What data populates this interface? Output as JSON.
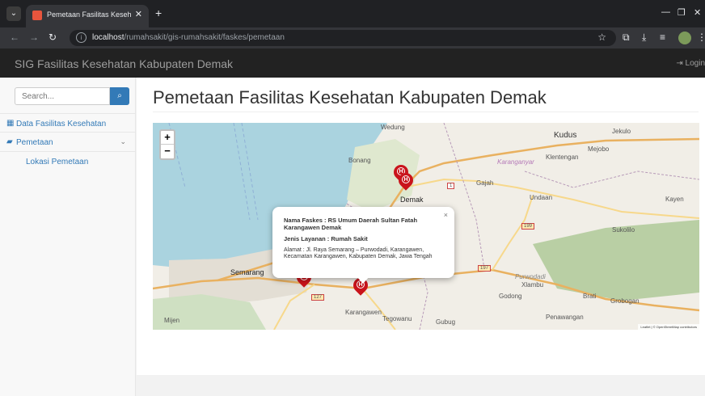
{
  "browser": {
    "tab_title": "Pemetaan Fasilitas Kesehatan K",
    "url_host": "localhost",
    "url_path": "/rumahsakit/gis-rumahsakit/faskes/pemetaan"
  },
  "navbar": {
    "brand": "SIG Fasilitas Kesehatan Kabupaten Demak",
    "login": "Login"
  },
  "sidebar": {
    "search_placeholder": "Search...",
    "items": [
      {
        "label": "Data Fasilitas Kesehatan",
        "icon": "table-icon"
      },
      {
        "label": "Pemetaan",
        "icon": "map-icon"
      }
    ],
    "sub_items": [
      {
        "label": "Lokasi Pemetaan"
      }
    ]
  },
  "main": {
    "title": "Pemetaan Fasilitas Kesehatan Kabupaten Demak"
  },
  "map": {
    "place_labels": {
      "wedung": "Wedung",
      "kudus": "Kudus",
      "jekulo": "Jekulo",
      "mejobo": "Mejobo",
      "bonang": "Bonang",
      "karanganyar": "Karanganyar",
      "klentengan": "Klentengan",
      "gajah": "Gajah",
      "demak": "Demak",
      "undaan": "Undaan",
      "kayen": "Kayen",
      "sukolilo": "Sukolilo",
      "semarang": "Semarang",
      "xlambu": "Xlambu",
      "godong": "Godong",
      "brati": "Brati",
      "grobogan": "Grobogan",
      "penawangan": "Penawangan",
      "karangawen": "Karangawen",
      "tegowanu": "Tegowanu",
      "gubug": "Gubug",
      "mijen": "Mijen",
      "purwodadi": "Purwodadi"
    },
    "road_numbers": [
      "1",
      "199",
      "197",
      "127"
    ],
    "zoom_in": "+",
    "zoom_out": "−",
    "attribution": "Leaflet | © OpenStreetMap contributors",
    "popup": {
      "name": "Nama Faskes : RS Umum Daerah Sultan Fatah Karangawen Demak",
      "type": "Jenis Layanan : Rumah Sakit",
      "address": "Alamat : Jl. Raya Semarang – Purwodadi, Karangawen, Kecamatan Karangawen, Kabupaten Demak, Jawa Tengah",
      "close": "×"
    },
    "marker_glyph": "H"
  }
}
